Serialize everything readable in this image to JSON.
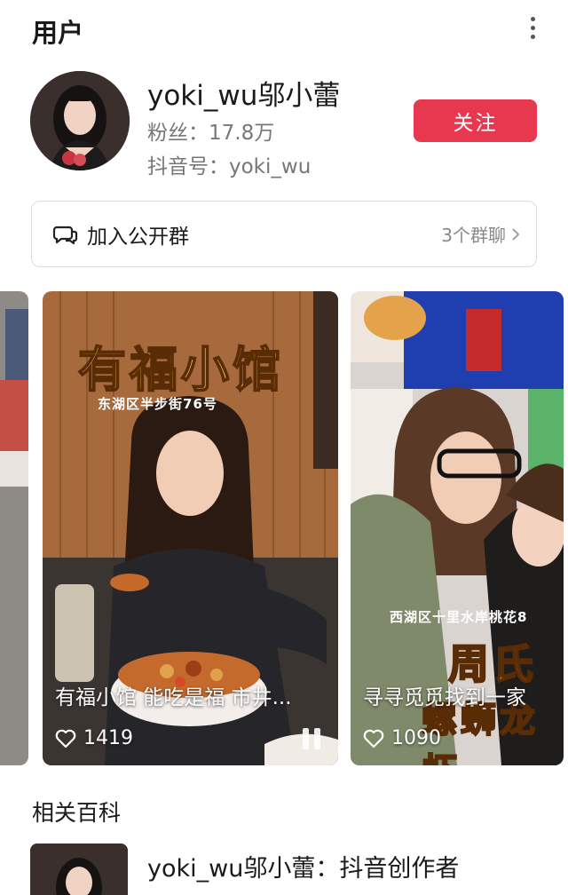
{
  "header": {
    "title": "用户"
  },
  "profile": {
    "username": "yoki_wu邬小蕾",
    "fans": "粉丝：17.8万",
    "douyin_id": "抖音号：yoki_wu",
    "follow_label": "关注"
  },
  "group": {
    "label": "加入公开群",
    "count": "3个群聊"
  },
  "videos": [
    {
      "overlay_title": "有福小馆",
      "overlay_location": "东湖区半步街76号",
      "caption": "有福小馆 能吃是福 市井...",
      "likes": "1419"
    },
    {
      "overlay_title": "周氏",
      "overlay_subtitle": "螺蛳龙虾",
      "overlay_location": "西湖区十里水岸桃花8",
      "caption": "寻寻觅觅找到一家",
      "likes": "1090"
    }
  ],
  "wiki": {
    "section_title": "相关百科",
    "entry_title": "yoki_wu邬小蕾：抖音创作者"
  },
  "colors": {
    "accent": "#e8384f"
  }
}
